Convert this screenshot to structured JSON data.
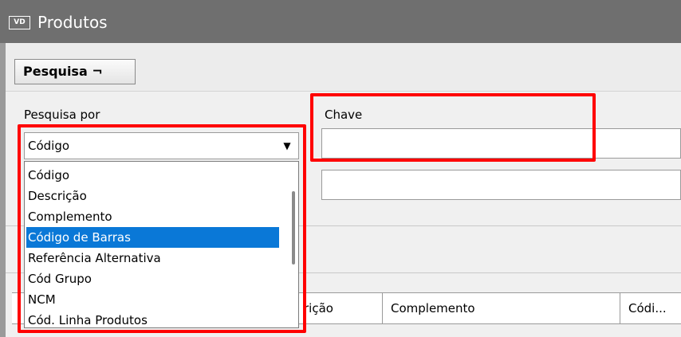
{
  "window": {
    "app_icon_text": "VD",
    "title": "Produtos"
  },
  "toolbar": {
    "search_tab_label": "Pesquisa ¬"
  },
  "search": {
    "field_label": "Pesquisa por",
    "selected_value": "Código",
    "key_label": "Chave",
    "key_value": "",
    "second_value": ""
  },
  "dropdown": {
    "options": [
      "Código",
      "Descrição",
      "Complemento",
      "Código de Barras",
      "Referência Alternativa",
      "Cód Grupo",
      "NCM",
      "Cód. Linha Produtos"
    ],
    "highlighted_option": "Código de Barras"
  },
  "grid": {
    "columns": [
      "rição",
      "Complemento",
      "Códi..."
    ]
  },
  "colors": {
    "highlight": "#ff0000",
    "selection": "#0a78d7",
    "titlebar": "#6f6f6f"
  }
}
